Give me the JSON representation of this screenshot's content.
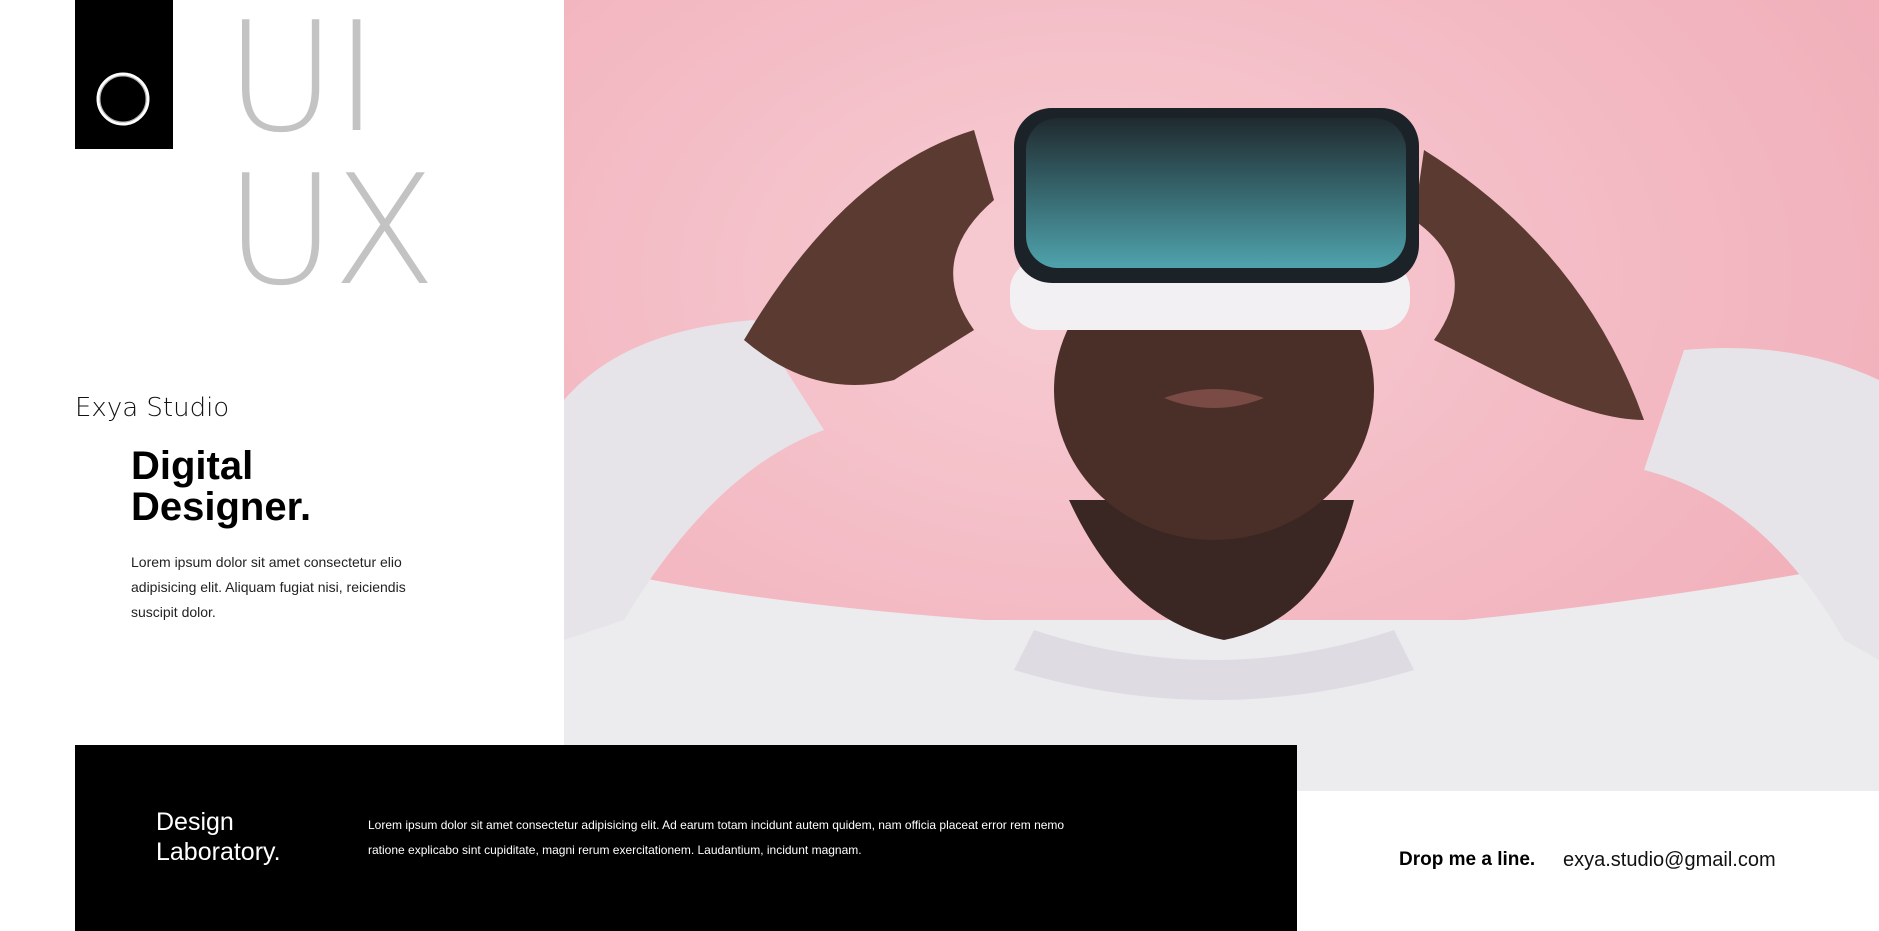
{
  "brand": {
    "logo_icon": "circle-ring-icon",
    "big_line1": "UI",
    "big_line2": "UX",
    "studio_name": "Exya Studio"
  },
  "hero": {
    "headline_line1": "Digital",
    "headline_line2": "Designer.",
    "intro": "Lorem ipsum dolor sit amet consectetur elio adipisicing elit. Aliquam fugiat nisi, reiciendis suscipit dolor.",
    "image_alt": "person wearing VR headset on pink background",
    "background_color": "#f3b8c2"
  },
  "footer_band": {
    "title_line1": "Design",
    "title_line2": "Laboratory.",
    "text": "Lorem ipsum dolor sit amet consectetur adipisicing elit. Ad earum totam incidunt autem quidem, nam officia placeat error rem nemo ratione explicabo sint cupiditate, magni rerum exercitationem. Laudantium, incidunt magnam."
  },
  "contact": {
    "label": "Drop me a line.",
    "email": "exya.studio@gmail.com"
  }
}
